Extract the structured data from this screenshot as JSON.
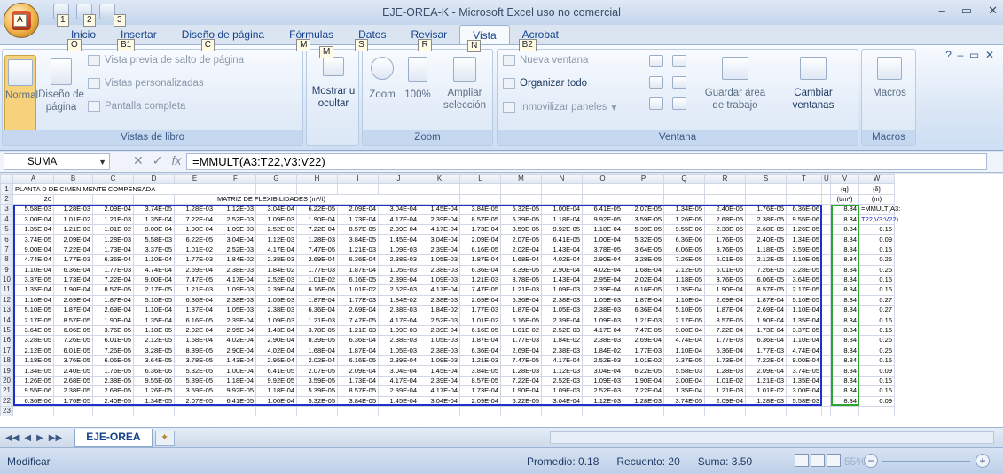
{
  "window": {
    "title": "EJE-OREA-K - Microsoft Excel uso no comercial"
  },
  "qat_keytips": [
    "1",
    "2",
    "3"
  ],
  "office_button": {
    "keytip": "A"
  },
  "tabs": [
    {
      "label": "Inicio",
      "keytip": "O"
    },
    {
      "label": "Insertar",
      "keytip": "B1"
    },
    {
      "label": "Diseño de página",
      "keytip": "C"
    },
    {
      "label": "Fórmulas",
      "keytip": "M"
    },
    {
      "label": "Datos",
      "keytip": "S"
    },
    {
      "label": "Revisar",
      "keytip": "R"
    },
    {
      "label": "Vista",
      "keytip": "N"
    },
    {
      "label": "Acrobat",
      "keytip": "B2"
    }
  ],
  "ribbon": {
    "vistas_libro": {
      "label": "Vistas de libro",
      "normal": "Normal",
      "diseno_pagina": "Diseño de página",
      "salto": "Vista previa de salto de página",
      "personalizadas": "Vistas personalizadas",
      "pantalla": "Pantalla completa"
    },
    "mostrar": {
      "label": "Mostrar u ocultar"
    },
    "zoom": {
      "label": "Zoom",
      "zoom": "Zoom",
      "pct": "100%",
      "ampliar": "Ampliar selección"
    },
    "ventana": {
      "label": "Ventana",
      "nueva": "Nueva ventana",
      "organizar": "Organizar todo",
      "inmovilizar": "Inmovilizar paneles",
      "guardar": "Guardar área de trabajo",
      "cambiar": "Cambiar ventanas"
    },
    "macros": {
      "label": "Macros",
      "btn": "Macros"
    }
  },
  "formula_bar": {
    "name_box": "SUMA",
    "formula": "=MMULT(A3:T22,V3:V22)"
  },
  "sheet": {
    "columns": [
      "A",
      "B",
      "C",
      "D",
      "E",
      "F",
      "G",
      "H",
      "I",
      "J",
      "K",
      "L",
      "M",
      "N",
      "O",
      "P",
      "Q",
      "R",
      "S",
      "T",
      "U",
      "V",
      "W"
    ],
    "row1_title": "PLANTA D  DE CIMEN  MENTE COMPENSADA",
    "row2_a": "20",
    "row2_matrix": "MATRIZ DE FLEXIBILIDADES (m³/t)",
    "v_header": "{q}",
    "w_header": "{δ}",
    "v_unit": "(t/m²)",
    "w_unit": "(m)",
    "rows": [
      [
        "5.58E-03",
        "1.28E-03",
        "2.09E-04",
        "3.74E-05",
        "1.28E-03",
        "1.12E-03",
        "3.04E-04",
        "6.22E-05",
        "2.09E-04",
        "3.04E-04",
        "1.45E-04",
        "3.84E-05",
        "5.32E-05",
        "1.00E-04",
        "6.41E-05",
        "2.07E-05",
        "1.34E-05",
        "2.40E-05",
        "1.76E-05",
        "6.36E-06",
        "8.34",
        "=MMULT(A3:"
      ],
      [
        "3.00E-04",
        "1.01E-02",
        "1.21E-03",
        "1.35E-04",
        "7.22E-04",
        "2.52E-03",
        "1.09E-03",
        "1.90E-04",
        "1.73E-04",
        "4.17E-04",
        "2.39E-04",
        "8.57E-05",
        "5.39E-05",
        "1.18E-04",
        "9.92E-05",
        "3.59E-05",
        "1.26E-05",
        "2.68E-05",
        "2.38E-05",
        "9.55E-06",
        "8.34",
        "T22,V3:V22)"
      ],
      [
        "1.35E-04",
        "1.21E-03",
        "1.01E-02",
        "9.00E-04",
        "1.90E-04",
        "1.09E-03",
        "2.52E-03",
        "7.22E-04",
        "8.57E-05",
        "2.39E-04",
        "4.17E-04",
        "1.73E-04",
        "3.59E-05",
        "9.92E-05",
        "1.18E-04",
        "5.39E-05",
        "9.55E-06",
        "2.38E-05",
        "2.68E-05",
        "1.26E-05",
        "8.34",
        "0.15"
      ],
      [
        "3.74E-05",
        "2.09E-04",
        "1.28E-03",
        "5.58E-03",
        "6.22E-05",
        "3.04E-04",
        "1.12E-03",
        "1.28E-03",
        "3.84E-05",
        "1.45E-04",
        "3.04E-04",
        "2.09E-04",
        "2.07E-05",
        "6.41E-05",
        "1.00E-04",
        "5.32E-05",
        "6.36E-06",
        "1.76E-05",
        "2.40E-05",
        "1.34E-05",
        "8.34",
        "0.09"
      ],
      [
        "9.00E-04",
        "7.22E-04",
        "1.73E-04",
        "3.37E-05",
        "1.01E-02",
        "2.52E-03",
        "4.17E-04",
        "7.47E-05",
        "1.21E-03",
        "1.09E-03",
        "2.39E-04",
        "6.16E-05",
        "2.02E-04",
        "1.43E-04",
        "3.78E-05",
        "3.64E-05",
        "6.06E-05",
        "3.76E-05",
        "1.18E-05",
        "3.59E-05",
        "8.34",
        "0.15"
      ],
      [
        "4.74E-04",
        "1.77E-03",
        "6.36E-04",
        "1.10E-04",
        "1.77E-03",
        "1.84E-02",
        "2.38E-03",
        "2.69E-04",
        "6.36E-04",
        "2.38E-03",
        "1.05E-03",
        "1.87E-04",
        "1.68E-04",
        "4.02E-04",
        "2.90E-04",
        "3.28E-05",
        "7.26E-05",
        "6.01E-05",
        "2.12E-05",
        "1.10E-05",
        "8.34",
        "0.26"
      ],
      [
        "1.10E-04",
        "6.36E-04",
        "1.77E-03",
        "4.74E-04",
        "2.69E-04",
        "2.38E-03",
        "1.84E-02",
        "1.77E-03",
        "1.87E-04",
        "1.05E-03",
        "2.38E-03",
        "6.36E-04",
        "8.39E-05",
        "2.90E-04",
        "4.02E-04",
        "1.68E-04",
        "2.12E-05",
        "6.01E-05",
        "7.26E-05",
        "3.28E-05",
        "8.34",
        "0.26"
      ],
      [
        "3.37E-05",
        "1.73E-04",
        "7.22E-04",
        "9.00E-04",
        "7.47E-05",
        "4.17E-04",
        "2.52E-03",
        "1.01E-02",
        "6.16E-05",
        "2.39E-04",
        "1.09E-03",
        "1.21E-03",
        "3.78E-05",
        "1.43E-04",
        "2.95E-04",
        "2.02E-04",
        "1.18E-05",
        "3.76E-05",
        "6.06E-05",
        "3.64E-05",
        "8.34",
        "0.15"
      ],
      [
        "1.35E-04",
        "1.90E-04",
        "8.57E-05",
        "2.17E-05",
        "1.21E-03",
        "1.09E-03",
        "2.39E-04",
        "6.16E-05",
        "1.01E-02",
        "2.52E-03",
        "4.17E-04",
        "7.47E-05",
        "1.21E-03",
        "1.09E-03",
        "2.39E-04",
        "6.16E-05",
        "1.35E-04",
        "1.90E-04",
        "8.57E-05",
        "2.17E-05",
        "8.34",
        "0.16"
      ],
      [
        "1.10E-04",
        "2.69E-04",
        "1.87E-04",
        "5.10E-05",
        "6.36E-04",
        "2.38E-03",
        "1.05E-03",
        "1.87E-04",
        "1.77E-03",
        "1.84E-02",
        "2.38E-03",
        "2.69E-04",
        "6.36E-04",
        "2.38E-03",
        "1.05E-03",
        "1.87E-04",
        "1.10E-04",
        "2.69E-04",
        "1.87E-04",
        "5.10E-05",
        "8.34",
        "0.27"
      ],
      [
        "5.10E-05",
        "1.87E-04",
        "2.69E-04",
        "1.10E-04",
        "1.87E-04",
        "1.05E-03",
        "2.38E-03",
        "6.36E-04",
        "2.69E-04",
        "2.38E-03",
        "1.84E-02",
        "1.77E-03",
        "1.87E-04",
        "1.05E-03",
        "2.38E-03",
        "6.36E-04",
        "5.10E-05",
        "1.87E-04",
        "2.69E-04",
        "1.10E-04",
        "8.34",
        "0.27"
      ],
      [
        "2.17E-05",
        "8.57E-05",
        "1.90E-04",
        "1.35E-04",
        "6.16E-05",
        "2.39E-04",
        "1.09E-03",
        "1.21E-03",
        "7.47E-05",
        "4.17E-04",
        "2.52E-03",
        "1.01E-02",
        "6.16E-05",
        "2.39E-04",
        "1.09E-03",
        "1.21E-03",
        "2.17E-05",
        "8.57E-05",
        "1.90E-04",
        "1.35E-04",
        "8.34",
        "0.16"
      ],
      [
        "3.64E-05",
        "6.06E-05",
        "3.76E-05",
        "1.18E-05",
        "2.02E-04",
        "2.95E-04",
        "1.43E-04",
        "3.78E-05",
        "1.21E-03",
        "1.09E-03",
        "2.39E-04",
        "6.16E-05",
        "1.01E-02",
        "2.52E-03",
        "4.17E-04",
        "7.47E-05",
        "9.00E-04",
        "7.22E-04",
        "1.73E-04",
        "3.37E-05",
        "8.34",
        "0.15"
      ],
      [
        "3.28E-05",
        "7.26E-05",
        "6.01E-05",
        "2.12E-05",
        "1.68E-04",
        "4.02E-04",
        "2.90E-04",
        "8.39E-05",
        "6.36E-04",
        "2.38E-03",
        "1.05E-03",
        "1.87E-04",
        "1.77E-03",
        "1.84E-02",
        "2.38E-03",
        "2.69E-04",
        "4.74E-04",
        "1.77E-03",
        "6.36E-04",
        "1.10E-04",
        "8.34",
        "0.26"
      ],
      [
        "2.12E-05",
        "6.01E-05",
        "7.26E-05",
        "3.28E-05",
        "8.39E-05",
        "2.90E-04",
        "4.02E-04",
        "1.68E-04",
        "1.87E-04",
        "1.05E-03",
        "2.38E-03",
        "6.36E-04",
        "2.69E-04",
        "2.38E-03",
        "1.84E-02",
        "1.77E-03",
        "1.10E-04",
        "6.36E-04",
        "1.77E-03",
        "4.74E-04",
        "8.34",
        "0.26"
      ],
      [
        "1.18E-05",
        "3.76E-05",
        "6.06E-05",
        "3.64E-05",
        "3.78E-05",
        "1.43E-04",
        "2.95E-04",
        "2.02E-04",
        "6.16E-05",
        "2.39E-04",
        "1.09E-03",
        "1.21E-03",
        "7.47E-05",
        "4.17E-04",
        "2.52E-03",
        "1.01E-02",
        "3.37E-05",
        "1.73E-04",
        "7.22E-04",
        "9.00E-04",
        "8.34",
        "0.15"
      ],
      [
        "1.34E-05",
        "2.40E-05",
        "1.76E-05",
        "6.36E-06",
        "5.32E-05",
        "1.00E-04",
        "6.41E-05",
        "2.07E-05",
        "2.09E-04",
        "3.04E-04",
        "1.45E-04",
        "3.84E-05",
        "1.28E-03",
        "1.12E-03",
        "3.04E-04",
        "6.22E-05",
        "5.58E-03",
        "1.28E-03",
        "2.09E-04",
        "3.74E-05",
        "8.34",
        "0.09"
      ],
      [
        "1.26E-05",
        "2.68E-05",
        "2.38E-05",
        "9.55E-06",
        "5.39E-05",
        "1.18E-04",
        "9.92E-05",
        "3.59E-05",
        "1.73E-04",
        "4.17E-04",
        "2.39E-04",
        "8.57E-05",
        "7.22E-04",
        "2.52E-03",
        "1.09E-03",
        "1.90E-04",
        "3.00E-04",
        "1.01E-02",
        "1.21E-03",
        "1.35E-04",
        "8.34",
        "0.15"
      ],
      [
        "9.55E-06",
        "2.38E-05",
        "2.68E-05",
        "1.26E-05",
        "3.59E-05",
        "9.92E-05",
        "1.18E-04",
        "5.39E-05",
        "8.57E-05",
        "2.39E-04",
        "4.17E-04",
        "1.73E-04",
        "1.90E-04",
        "1.09E-03",
        "2.52E-03",
        "7.22E-04",
        "1.35E-04",
        "1.21E-03",
        "1.01E-02",
        "3.00E-04",
        "8.34",
        "0.15"
      ],
      [
        "6.36E-06",
        "1.76E-05",
        "2.40E-05",
        "1.34E-05",
        "2.07E-05",
        "6.41E-05",
        "1.00E-04",
        "5.32E-05",
        "3.84E-05",
        "1.45E-04",
        "3.04E-04",
        "2.09E-04",
        "6.22E-05",
        "3.04E-04",
        "1.12E-03",
        "1.28E-03",
        "3.74E-05",
        "2.09E-04",
        "1.28E-03",
        "5.58E-03",
        "8.34",
        "0.09"
      ]
    ]
  },
  "sheet_tabs": {
    "active": "EJE-OREA"
  },
  "status": {
    "mode": "Modificar",
    "promedio": "Promedio: 0.18",
    "recuento": "Recuento: 20",
    "suma": "Suma: 3.50",
    "zoom": "55%"
  }
}
